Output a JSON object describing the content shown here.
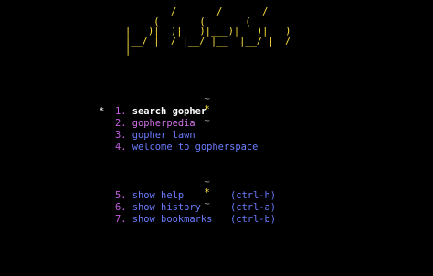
{
  "logo": {
    "ascii": "        /       /       /\n ___ (__ ___ (__ ___ (__\n|   )|  )|   )|___)|   )|   )\n|__/ |  / |__/ |__  |__/ |  /\n|"
  },
  "dividers": {
    "top": {
      "tilde_left": "~",
      "star": "*",
      "tilde_right": "~"
    },
    "bottom": {
      "tilde_left": "~",
      "star": "*",
      "tilde_right": "~"
    }
  },
  "menu": {
    "selected_marker": "*",
    "items": [
      {
        "number": "1.",
        "label": "search gopher"
      },
      {
        "number": "2.",
        "label": "gopherpedia"
      },
      {
        "number": "3.",
        "label": "gopher lawn"
      },
      {
        "number": "4.",
        "label": "welcome to gopherspace"
      }
    ]
  },
  "commands": [
    {
      "number": "5.",
      "label": "show help",
      "shortcut": "(ctrl-h)"
    },
    {
      "number": "6.",
      "label": "show history",
      "shortcut": "(ctrl-a)"
    },
    {
      "number": "7.",
      "label": "show bookmarks",
      "shortcut": "(ctrl-b)"
    }
  ],
  "colors": {
    "background": "#000000",
    "logo": "#ffe23f",
    "number": "#c25fe0",
    "link": "#6a7cff",
    "selected": "#ffffff"
  }
}
